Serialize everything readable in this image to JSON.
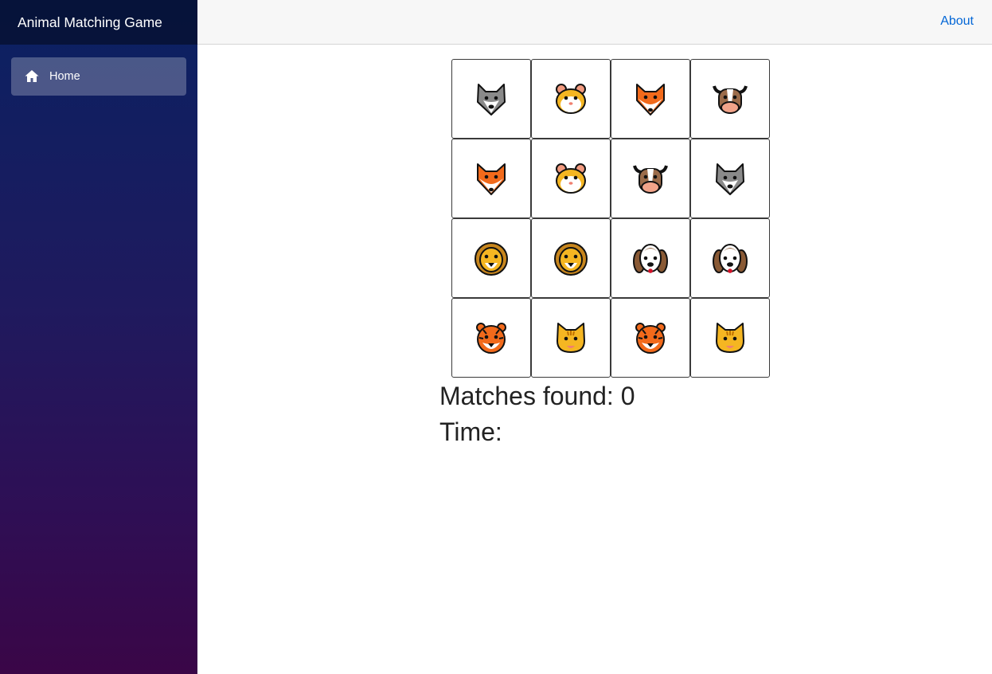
{
  "app": {
    "title": "Animal Matching Game"
  },
  "nav": {
    "items": [
      {
        "label": "Home",
        "icon": "home-icon",
        "active": true
      }
    ]
  },
  "topbar": {
    "about_label": "About"
  },
  "board": {
    "cells": [
      {
        "animal": "wolf"
      },
      {
        "animal": "hamster"
      },
      {
        "animal": "fox"
      },
      {
        "animal": "cow"
      },
      {
        "animal": "fox"
      },
      {
        "animal": "hamster"
      },
      {
        "animal": "cow"
      },
      {
        "animal": "wolf"
      },
      {
        "animal": "lion"
      },
      {
        "animal": "lion"
      },
      {
        "animal": "dog"
      },
      {
        "animal": "dog"
      },
      {
        "animal": "tiger"
      },
      {
        "animal": "cat"
      },
      {
        "animal": "tiger"
      },
      {
        "animal": "cat"
      }
    ]
  },
  "stats": {
    "matches_label": "Matches found: 0",
    "time_label": "Time:"
  },
  "colors": {
    "sidebar_top": "#0a2162",
    "sidebar_bottom": "#3a0647",
    "link": "#0366d6",
    "topbar_bg": "#f7f7f7"
  }
}
